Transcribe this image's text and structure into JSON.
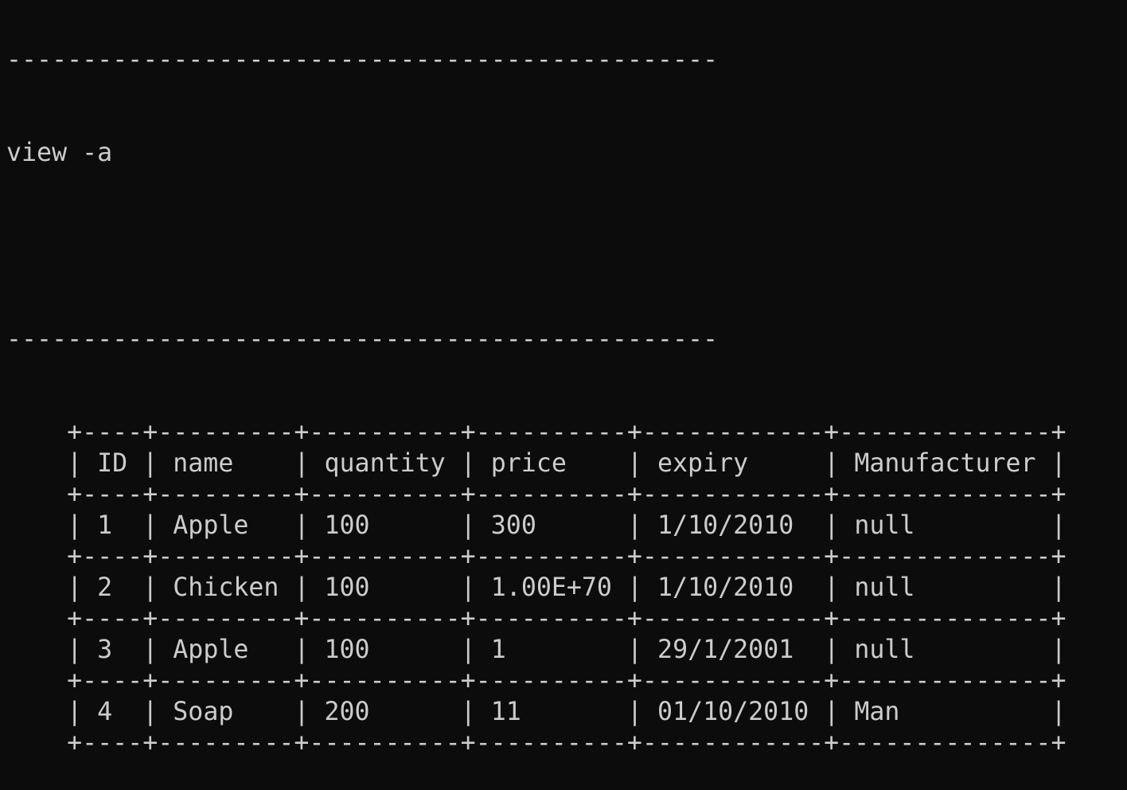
{
  "terminal": {
    "command_rule": "-----------------------------------------------",
    "command": "view -a",
    "table": {
      "indent": "    ",
      "columns": [
        "ID",
        "name",
        "quantity",
        "price",
        "expiry",
        "Manufacturer"
      ],
      "rows": [
        [
          "1",
          "Apple",
          "100",
          "300",
          "1/10/2010",
          "null"
        ],
        [
          "2",
          "Chicken",
          "100",
          "1.00E+70",
          "1/10/2010",
          "null"
        ],
        [
          "3",
          "Apple",
          "100",
          "1",
          "29/1/2001",
          "null"
        ],
        [
          "4",
          "Soap",
          "200",
          "11",
          "01/10/2010",
          "Man"
        ]
      ]
    }
  }
}
